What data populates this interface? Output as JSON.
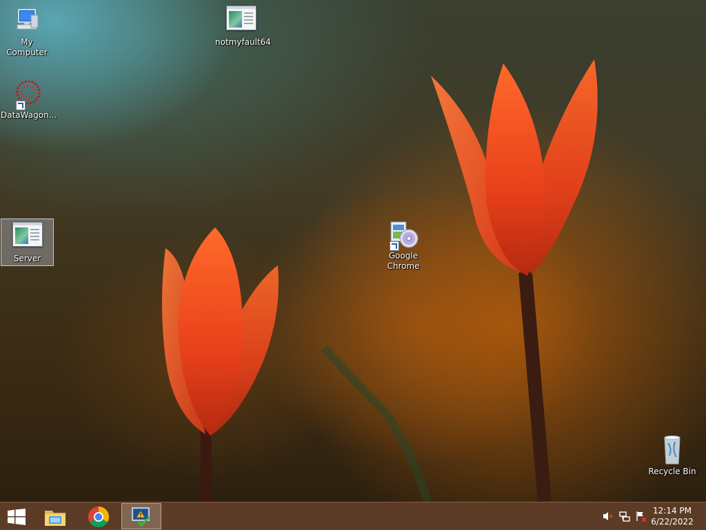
{
  "desktop": {
    "icons": [
      {
        "label": "My Computer"
      },
      {
        "label": "notmyfault64"
      },
      {
        "label": "DataWagon..."
      },
      {
        "label": "Server"
      },
      {
        "label": "Google Chrome"
      },
      {
        "label": "Recycle Bin"
      }
    ]
  },
  "taskbar": {
    "start": {
      "icon": "windows-logo-icon"
    },
    "pinned": [
      {
        "name": "file-explorer",
        "icon": "folder-icon"
      },
      {
        "name": "google-chrome",
        "icon": "chrome-icon"
      },
      {
        "name": "active-app",
        "icon": "monitor-warning-icon",
        "active": true
      }
    ],
    "tray": {
      "icons": [
        "speaker-muted-icon",
        "network-icon",
        "action-center-flag-icon"
      ],
      "time": "12:14 PM",
      "date": "6/22/2022"
    }
  },
  "colors": {
    "taskbar": "#5f3e28",
    "tulip": "#e8401a"
  }
}
